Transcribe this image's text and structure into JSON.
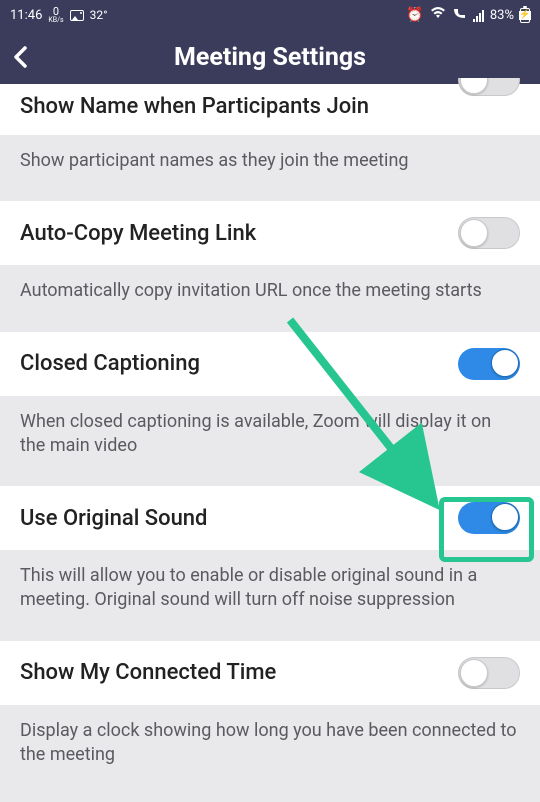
{
  "status_bar": {
    "time": "11:46",
    "kbps_value": "0",
    "kbps_label": "KB/s",
    "temp": "32°",
    "battery": "83%"
  },
  "header": {
    "title": "Meeting Settings"
  },
  "settings": [
    {
      "title": "Show Name when Participants Join",
      "desc": "Show participant names as they join the meeting",
      "on": false,
      "half": true
    },
    {
      "title": "Auto-Copy Meeting Link",
      "desc": "Automatically copy invitation URL once the meeting starts",
      "on": false,
      "half": false
    },
    {
      "title": "Closed Captioning",
      "desc": "When closed captioning is available, Zoom will display it on the main video",
      "on": true,
      "half": false
    },
    {
      "title": "Use Original Sound",
      "desc": "This will allow you to enable or disable original sound in a meeting. Original sound will turn off noise suppression",
      "on": true,
      "half": false
    },
    {
      "title": "Show My Connected Time",
      "desc": "Display a clock showing how long you have been connected to the meeting",
      "on": false,
      "half": false
    }
  ]
}
